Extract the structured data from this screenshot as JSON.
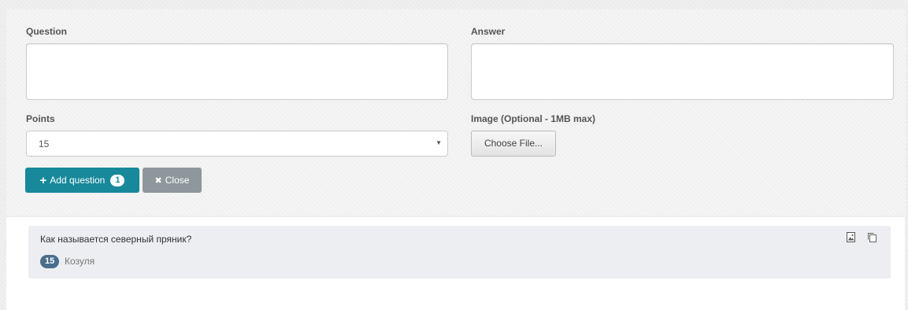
{
  "form": {
    "question_label": "Question",
    "question_value": "",
    "answer_label": "Answer",
    "answer_value": "",
    "points_label": "Points",
    "points_value": "15",
    "image_label": "Image (Optional - 1MB max)",
    "choose_file_label": "Choose File...",
    "add_question_label": "Add question",
    "add_question_count": "1",
    "close_label": "Close"
  },
  "questions": [
    {
      "text": "Как называется северный пряник?",
      "points": "15",
      "answer": "Козуля",
      "icons": [
        "image-icon",
        "copy-icon"
      ]
    }
  ],
  "colors": {
    "primary": "#17899a",
    "secondary": "#8e979c",
    "badge": "#4a6d8c"
  }
}
